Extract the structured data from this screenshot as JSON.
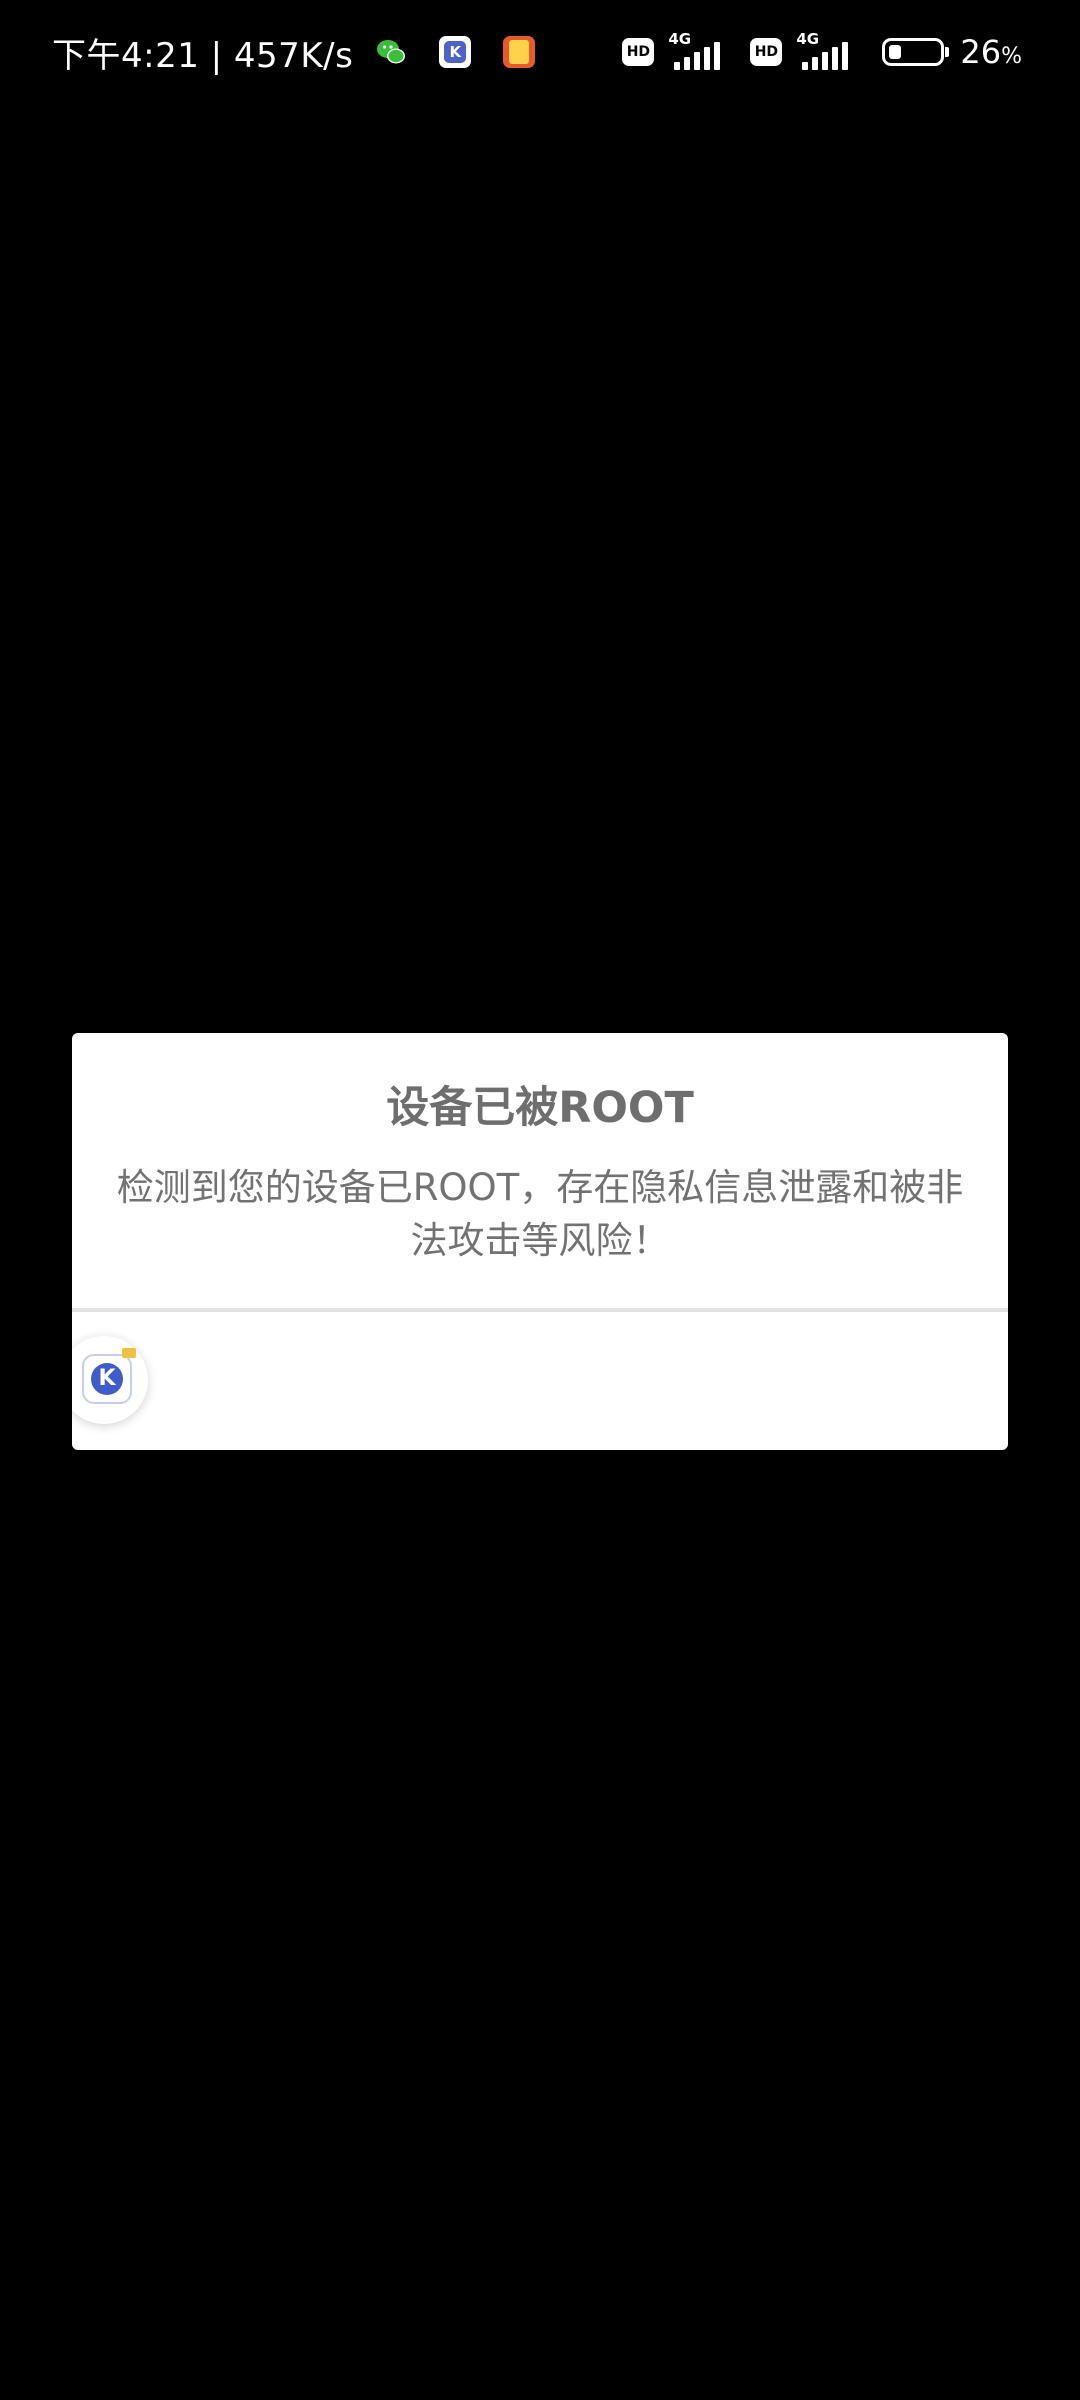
{
  "status_bar": {
    "time_speed": "下午4:21 | 457K/s",
    "notifications": [
      "wechat-icon",
      "k-app-icon",
      "red-app-icon"
    ],
    "sim1": {
      "badge": "HD",
      "network": "4G"
    },
    "sim2": {
      "badge": "HD",
      "network": "4G"
    },
    "battery_level": 0.26,
    "battery_percent": "26",
    "battery_unit": "%"
  },
  "dialog": {
    "title": "设备已被ROOT",
    "message": "检测到您的设备已ROOT，存在隐私信息泄露和被非法攻击等风险！",
    "floating_icon": "k-app-icon"
  },
  "colors": {
    "background": "#000000",
    "dialog_bg": "#ffffff",
    "title_text": "#6e6e6e",
    "message_text": "#727272",
    "divider": "#e2e2e2",
    "app_accent": "#3f5cc9",
    "wechat_green": "#3bbf3b"
  }
}
